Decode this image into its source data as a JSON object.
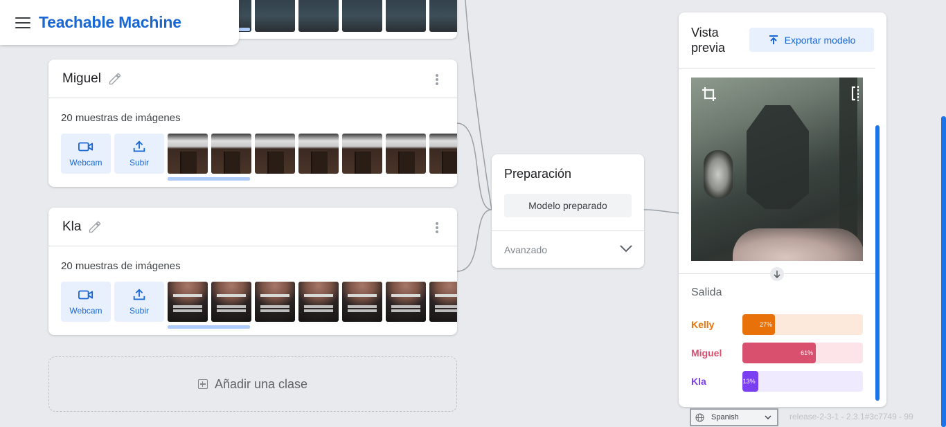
{
  "app": {
    "title": "Teachable Machine"
  },
  "classes": [
    {
      "name": "Miguel",
      "samples_label": "20 muestras de imágenes",
      "webcam_label": "Webcam",
      "upload_label": "Subir"
    },
    {
      "name": "Kla",
      "samples_label": "20 muestras de imágenes",
      "webcam_label": "Webcam",
      "upload_label": "Subir"
    }
  ],
  "add_class_label": "Añadir una clase",
  "training": {
    "title": "Preparación",
    "button_label": "Modelo preparado",
    "advanced_label": "Avanzado"
  },
  "preview": {
    "title": "Vista previa",
    "export_label": "Exportar modelo",
    "output_title": "Salida",
    "outputs": [
      {
        "label": "Kelly",
        "percent_text": "27%",
        "value": 0.27,
        "color": "#e8710a",
        "track_color": "#fde8dc"
      },
      {
        "label": "Miguel",
        "percent_text": "61%",
        "value": 0.61,
        "color": "#d94f6e",
        "track_color": "#fde4e9"
      },
      {
        "label": "Kla",
        "percent_text": "13%",
        "value": 0.13,
        "color": "#7b3ff2",
        "track_color": "#efeafd"
      }
    ]
  },
  "footer": {
    "language": "Spanish",
    "release": "release-2-3-1 - 2.3.1#3c7749 - 99"
  }
}
